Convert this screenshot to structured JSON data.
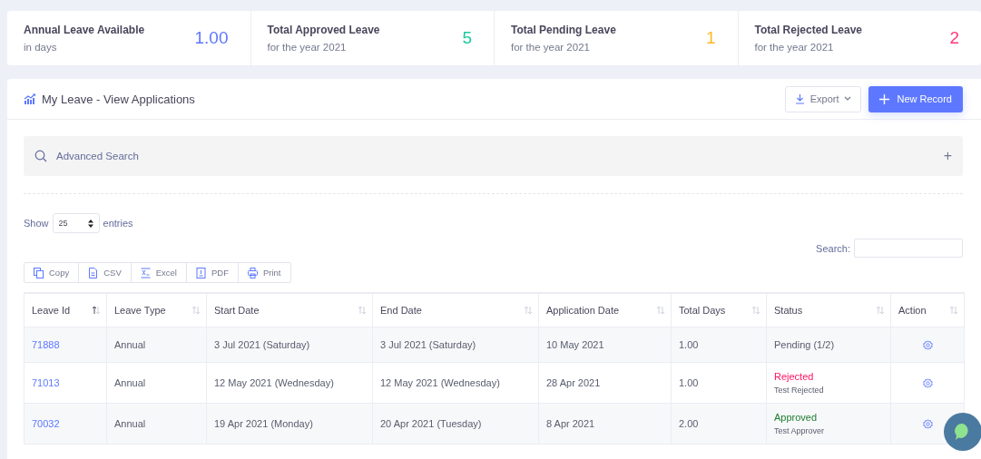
{
  "stats": [
    {
      "label": "Annual Leave Available",
      "sub": "in days",
      "value": "1.00",
      "color": "#5d78ff"
    },
    {
      "label": "Total Approved Leave",
      "sub": "for the year 2021",
      "value": "5",
      "color": "#1dc9a0"
    },
    {
      "label": "Total Pending Leave",
      "sub": "for the year 2021",
      "value": "1",
      "color": "#ffb822"
    },
    {
      "label": "Total Rejected Leave",
      "sub": "for the year 2021",
      "value": "2",
      "color": "#fd397a"
    }
  ],
  "panel": {
    "title": "My Leave - View Applications",
    "export_label": "Export",
    "new_label": "New Record"
  },
  "advanced_search": {
    "label": "Advanced Search",
    "expander": "+"
  },
  "length": {
    "before": "Show",
    "value": "25",
    "after": "entries"
  },
  "search": {
    "label": "Search:"
  },
  "export_buttons": [
    {
      "kind": "copy",
      "label": "Copy"
    },
    {
      "kind": "csv",
      "label": "CSV"
    },
    {
      "kind": "excel",
      "label": "Excel"
    },
    {
      "kind": "pdf",
      "label": "PDF"
    },
    {
      "kind": "print",
      "label": "Print"
    }
  ],
  "table": {
    "columns": [
      {
        "label": "Leave Id",
        "sorted": true
      },
      {
        "label": "Leave Type",
        "sorted": false
      },
      {
        "label": "Start Date",
        "sorted": false
      },
      {
        "label": "End Date",
        "sorted": false
      },
      {
        "label": "Application Date",
        "sorted": false
      },
      {
        "label": "Total Days",
        "sorted": false
      },
      {
        "label": "Status",
        "sorted": false
      },
      {
        "label": "Action",
        "sorted": false
      }
    ],
    "rows": [
      {
        "id": "71888",
        "type": "Annual",
        "start": "3 Jul 2021 (Saturday)",
        "end": "3 Jul 2021 (Saturday)",
        "applied": "10 May 2021",
        "days": "1.00",
        "status": {
          "kind": "pending",
          "text": "Pending (1/2)"
        }
      },
      {
        "id": "71013",
        "type": "Annual",
        "start": "12 May 2021 (Wednesday)",
        "end": "12 May 2021 (Wednesday)",
        "applied": "28 Apr 2021",
        "days": "1.00",
        "status": {
          "kind": "rejected",
          "text": "Rejected",
          "note": "Test Rejected"
        }
      },
      {
        "id": "70032",
        "type": "Annual",
        "start": "19 Apr 2021 (Monday)",
        "end": "20 Apr 2021 (Tuesday)",
        "applied": "8 Apr 2021",
        "days": "2.00",
        "status": {
          "kind": "approved",
          "text": "Approved",
          "note": "Test Approver"
        }
      }
    ]
  }
}
